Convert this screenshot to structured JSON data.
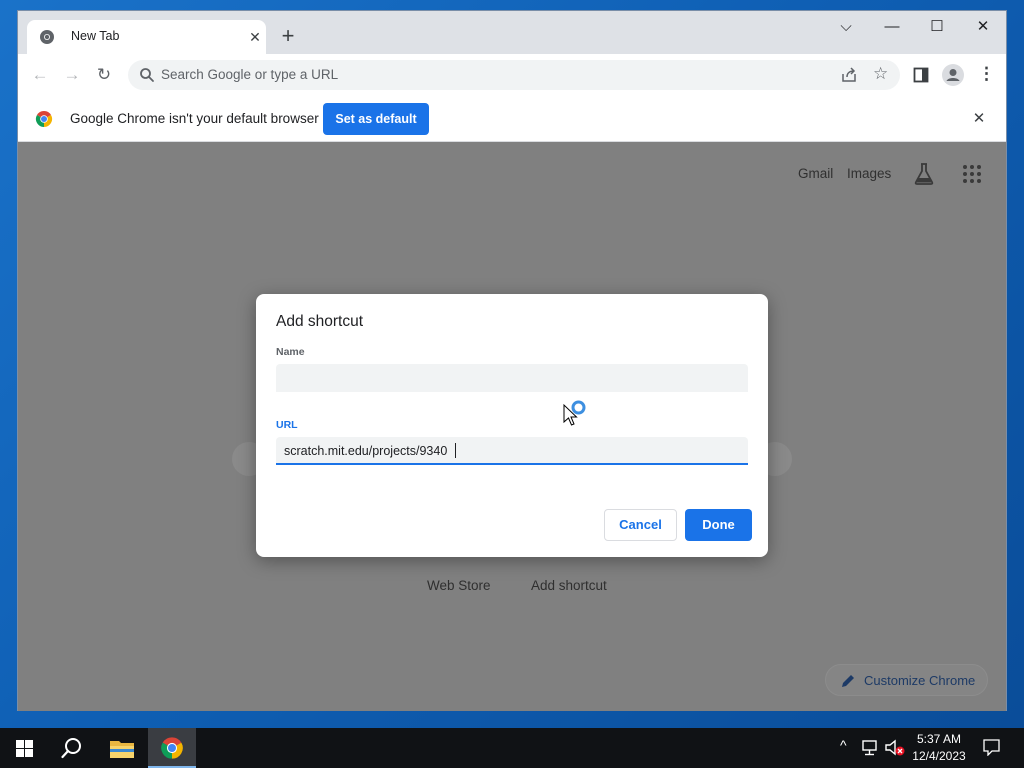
{
  "browser": {
    "tab": {
      "title": "New Tab"
    },
    "omnibox": {
      "placeholder": "Search Google or type a URL"
    },
    "infobar": {
      "message": "Google Chrome isn't your default browser",
      "button": "Set as default"
    }
  },
  "page": {
    "top_links": [
      "Gmail",
      "Images"
    ],
    "shortcuts": [
      "Web Store",
      "Add shortcut"
    ],
    "customize": "Customize Chrome"
  },
  "dialog": {
    "title": "Add shortcut",
    "name_label": "Name",
    "name_value": "",
    "url_label": "URL",
    "url_value": "scratch.mit.edu/projects/9340",
    "cancel": "Cancel",
    "done": "Done"
  },
  "taskbar": {
    "time": "5:37 AM",
    "date": "12/4/2023"
  },
  "colors": {
    "accent": "#1a73e8",
    "desktop": "#0f5fb4",
    "taskbar": "#101215"
  }
}
